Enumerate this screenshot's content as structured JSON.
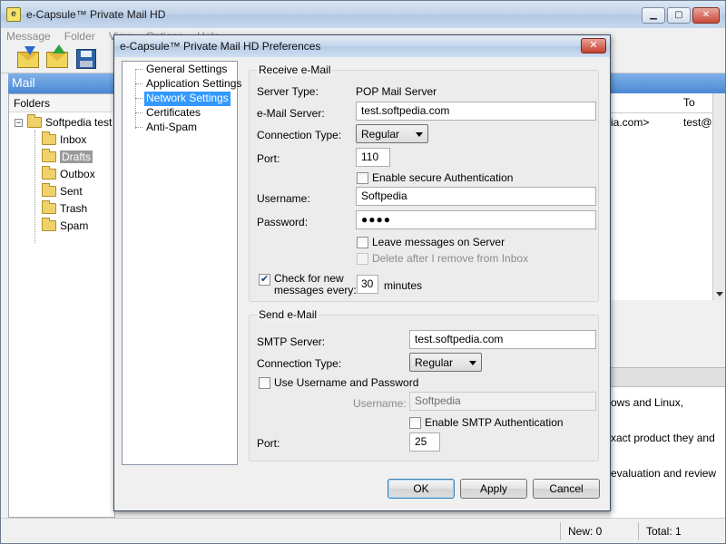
{
  "main_window": {
    "title": "e-Capsule™ Private Mail HD",
    "menu": [
      "Message",
      "Folder",
      "View",
      "Options",
      "Help"
    ],
    "mail_header": "Mail",
    "folders_title": "Folders",
    "tree": {
      "root": "Softpedia test",
      "items": [
        "Inbox",
        "Drafts",
        "Outbox",
        "Sent",
        "Trash",
        "Spam"
      ],
      "selected": "Drafts"
    },
    "list": {
      "col_to": "To",
      "row_from": "ia.com>",
      "row_to": "test@so"
    },
    "preview_lines": [
      "ows and Linux,",
      "",
      "xact product they and",
      "",
      "evaluation and review"
    ],
    "status": {
      "new": "New: 0",
      "total": "Total: 1"
    }
  },
  "dialog": {
    "title": "e-Capsule™ Private Mail HD Preferences",
    "nav": [
      "General Settings",
      "Application Settings",
      "Network Settings",
      "Certificates",
      "Anti-Spam"
    ],
    "nav_selected": "Network Settings",
    "receive": {
      "title": "Receive e-Mail",
      "server_type_label": "Server Type:",
      "server_type_value": "POP Mail Server",
      "email_server_label": "e-Mail Server:",
      "email_server_value": "test.softpedia.com",
      "connection_type_label": "Connection Type:",
      "connection_type_value": "Regular",
      "port_label": "Port:",
      "port_value": "110",
      "secure_auth_label": "Enable secure Authentication",
      "secure_auth_checked": false,
      "username_label": "Username:",
      "username_value": "Softpedia",
      "password_label": "Password:",
      "password_value": "●●●●",
      "leave_on_server_label": "Leave messages on Server",
      "leave_on_server_checked": false,
      "delete_after_label": "Delete after I remove from Inbox",
      "delete_after_checked": false,
      "check_new_label_1": "Check for new",
      "check_new_label_2": "messages every:",
      "check_new_checked": true,
      "check_interval_value": "30",
      "check_interval_unit": "minutes"
    },
    "send": {
      "title": "Send e-Mail",
      "smtp_server_label": "SMTP Server:",
      "smtp_server_value": "test.softpedia.com",
      "connection_type_label": "Connection Type:",
      "connection_type_value": "Regular",
      "use_auth_label": "Use Username and Password",
      "use_auth_checked": false,
      "username_label": "Username:",
      "username_value": "Softpedia",
      "smtp_auth_label": "Enable SMTP Authentication",
      "smtp_auth_checked": false,
      "port_label": "Port:",
      "port_value": "25"
    },
    "buttons": {
      "ok": "OK",
      "apply": "Apply",
      "cancel": "Cancel"
    }
  }
}
